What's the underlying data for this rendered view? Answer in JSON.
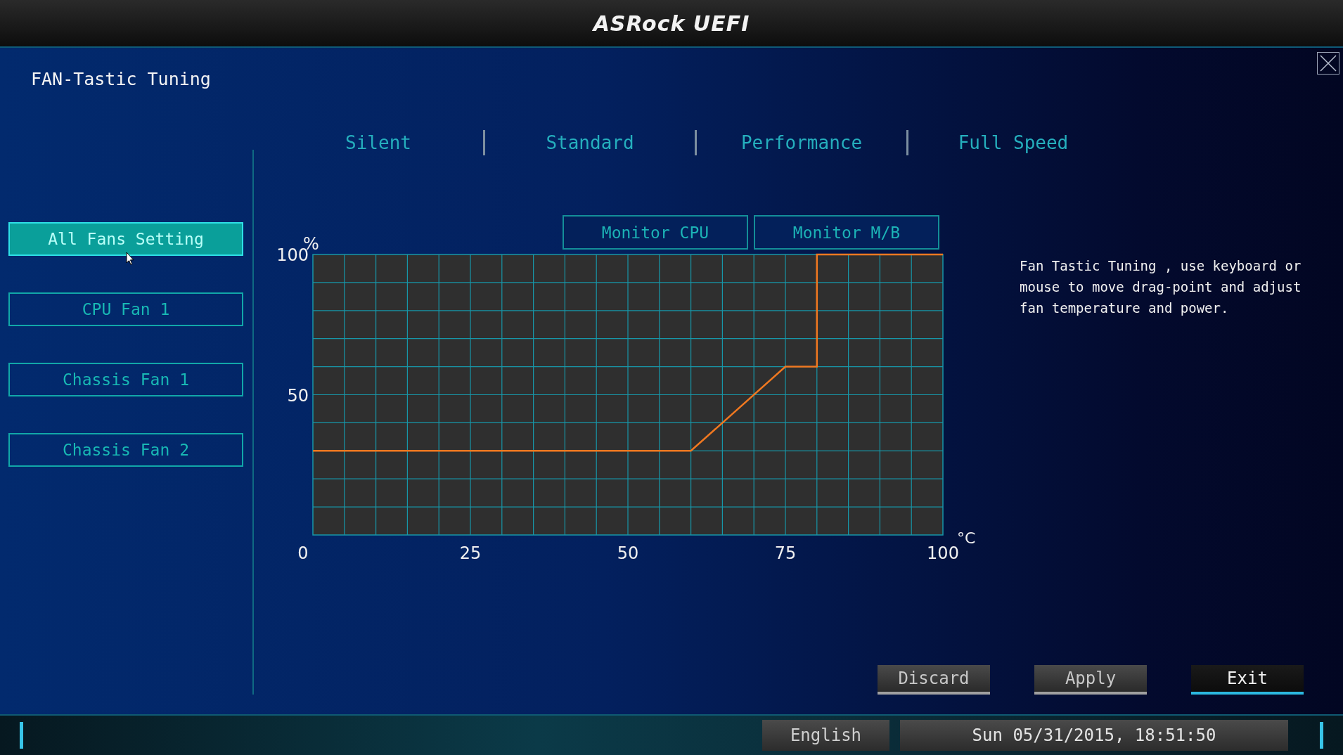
{
  "header": {
    "logo": "ASRock UEFI"
  },
  "page": {
    "title": "FAN-Tastic Tuning"
  },
  "modes": [
    {
      "label": "Silent"
    },
    {
      "label": "Standard"
    },
    {
      "label": "Performance"
    },
    {
      "label": "Full Speed"
    }
  ],
  "sidebar": {
    "items": [
      {
        "label": "All Fans Setting",
        "selected": true
      },
      {
        "label": "CPU Fan 1",
        "selected": false
      },
      {
        "label": "Chassis Fan 1",
        "selected": false
      },
      {
        "label": "Chassis Fan 2",
        "selected": false
      }
    ]
  },
  "monitor_buttons": [
    "Monitor CPU",
    "Monitor M/B"
  ],
  "fan_curve": {
    "chart_data": {
      "type": "line",
      "xlabel": "°C",
      "ylabel": "%",
      "x": [
        0,
        60,
        75,
        80,
        80,
        100
      ],
      "series": [
        {
          "color": "#f07820",
          "values": [
            30,
            30,
            60,
            60,
            100,
            100
          ]
        }
      ],
      "grid": true,
      "xlim": [
        0,
        100
      ],
      "ylim": [
        0,
        100
      ],
      "xticks": [
        0,
        25,
        50,
        75,
        100
      ],
      "yticks": [
        50,
        100
      ]
    }
  },
  "description": "Fan Tastic Tuning , use keyboard or mouse to move drag-point and adjust fan temperature and power.",
  "actions": [
    {
      "label": "Discard",
      "focused": false
    },
    {
      "label": "Apply",
      "focused": false
    },
    {
      "label": "Exit",
      "focused": true
    }
  ],
  "status_bar": {
    "language": "English",
    "datetime": "Sun 05/31/2015, 18:51:50"
  }
}
